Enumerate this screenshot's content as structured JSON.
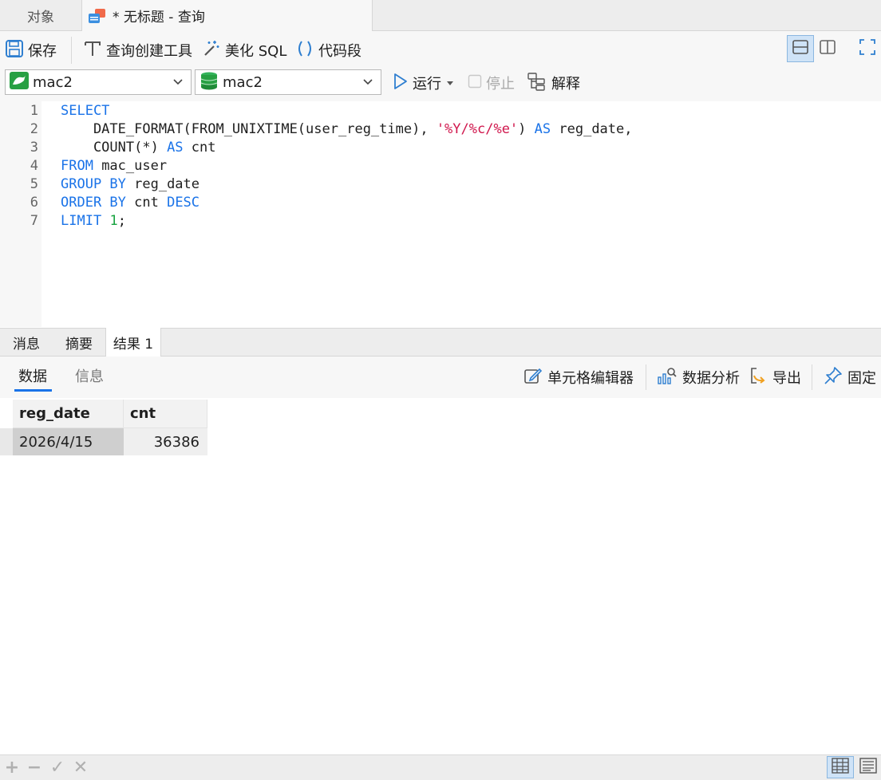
{
  "tabs": {
    "objects_label": "对象",
    "query_title": "* 无标题 - 查询"
  },
  "toolbar": {
    "save": "保存",
    "query_builder": "查询创建工具",
    "beautify": "美化 SQL",
    "snippet": "代码段"
  },
  "connection": {
    "connection_value": "mac2",
    "database_value": "mac2",
    "run": "运行",
    "stop": "停止",
    "explain": "解释"
  },
  "editor": {
    "line_numbers": [
      "1",
      "2",
      "3",
      "4",
      "5",
      "6",
      "7"
    ],
    "lines": [
      [
        {
          "t": "SELECT",
          "c": "kw"
        }
      ],
      [
        {
          "t": "    DATE_FORMAT(FROM_UNIXTIME(user_reg_time), ",
          "c": ""
        },
        {
          "t": "'%Y/%c/%e'",
          "c": "str"
        },
        {
          "t": ") ",
          "c": ""
        },
        {
          "t": "AS",
          "c": "kw"
        },
        {
          "t": " reg_date,",
          "c": ""
        }
      ],
      [
        {
          "t": "    COUNT(*) ",
          "c": ""
        },
        {
          "t": "AS",
          "c": "kw"
        },
        {
          "t": " cnt",
          "c": ""
        }
      ],
      [
        {
          "t": "FROM",
          "c": "kw"
        },
        {
          "t": " mac_user",
          "c": ""
        }
      ],
      [
        {
          "t": "GROUP BY",
          "c": "kw"
        },
        {
          "t": " reg_date",
          "c": ""
        }
      ],
      [
        {
          "t": "ORDER BY",
          "c": "kw"
        },
        {
          "t": " cnt ",
          "c": ""
        },
        {
          "t": "DESC",
          "c": "kw"
        }
      ],
      [
        {
          "t": "LIMIT",
          "c": "kw"
        },
        {
          "t": " ",
          "c": ""
        },
        {
          "t": "1",
          "c": "num"
        },
        {
          "t": ";",
          "c": ""
        }
      ]
    ]
  },
  "result_tabs": [
    "消息",
    "摘要",
    "结果 1"
  ],
  "subtabs": {
    "data": "数据",
    "info": "信息"
  },
  "result_tools": {
    "cell_editor": "单元格编辑器",
    "data_analysis": "数据分析",
    "export": "导出",
    "pin": "固定"
  },
  "grid": {
    "columns": [
      "reg_date",
      "cnt"
    ],
    "rows": [
      [
        "2026/4/15",
        "36386"
      ]
    ]
  },
  "colors": {
    "keyword": "#1a73e8",
    "string": "#d0174d",
    "number": "#18a340",
    "accent": "#1a73e8"
  },
  "icons": {
    "save": "save-icon",
    "query_builder": "query-builder-icon",
    "beautify": "magic-wand-icon",
    "snippet": "parentheses-icon",
    "run": "play-icon",
    "explain": "explain-icon",
    "cell_editor": "edit-icon",
    "data_analysis": "chart-search-icon",
    "export": "export-icon",
    "pin": "pin-icon"
  }
}
